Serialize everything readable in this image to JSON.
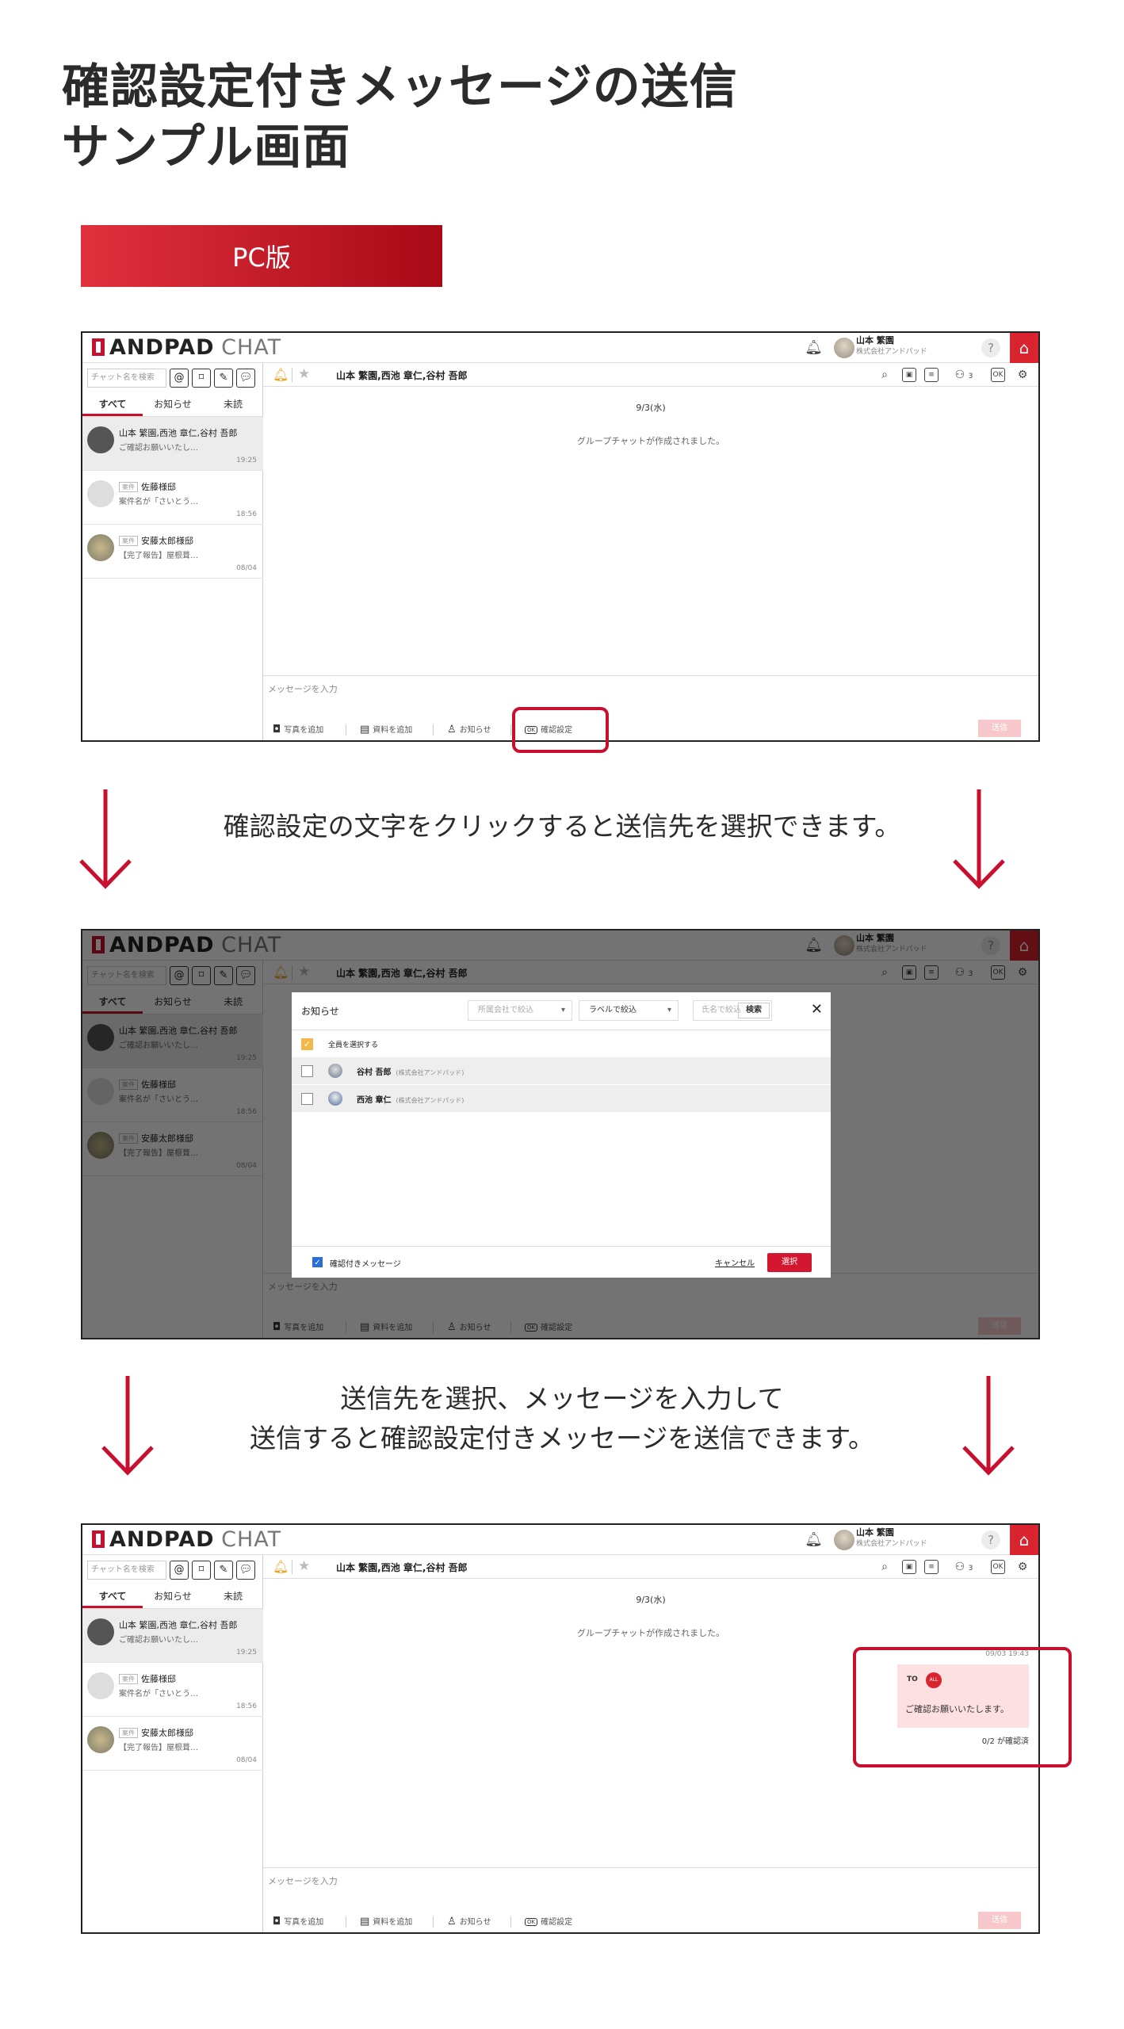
{
  "page": {
    "title_line1": "確認設定付きメッセージの送信",
    "title_line2": "サンプル画面",
    "badge": "PC版",
    "caption1": "確認設定の文字をクリックすると送信先を選択できます。",
    "caption2_line1": "送信先を選択、メッセージを入力して",
    "caption2_line2": "送信すると確認設定付きメッセージを送信できます。"
  },
  "app": {
    "logo_bold": "ANDPAD",
    "logo_light": "CHAT",
    "user_name": "山本 繁園",
    "user_company": "株式会社アンドパッド",
    "help": "?",
    "search_placeholder": "チャット名を検索",
    "tabs": [
      "すべて",
      "お知らせ",
      "未読"
    ],
    "rooms": [
      {
        "name": "山本 繁園,西池 章仁,谷村 吾郎",
        "tag": "",
        "msg": "ご確認お願いいたし…",
        "time": "19:25"
      },
      {
        "name": "佐藤様邸",
        "tag": "案件",
        "msg": "案件名が「さいとう…",
        "time": "18:56"
      },
      {
        "name": "安藤太郎様邸",
        "tag": "案件",
        "msg": "【完了報告】屋根葺…",
        "time": "08/04"
      }
    ],
    "chat_title": "山本 繁園,西池 章仁,谷村 吾郎",
    "member_count": "3",
    "date": "9/3(水)",
    "system_message": "グループチャットが作成されました。",
    "input_placeholder": "メッセージを入力",
    "toolbar": {
      "photo": "写真を追加",
      "doc": "資料を追加",
      "notice": "お知らせ",
      "confirm": "確認設定",
      "send": "送信"
    }
  },
  "modal": {
    "title": "お知らせ",
    "company_filter": "所属会社で絞込",
    "label_filter": "ラベルで絞込",
    "name_filter": "氏名で絞込",
    "search": "検索",
    "select_all": "全員を選択する",
    "members": [
      {
        "name": "谷村 吾郎",
        "company": "(株式会社アンドパッド)"
      },
      {
        "name": "西池 章仁",
        "company": "(株式会社アンドパッド)"
      }
    ],
    "confirm_label": "確認付きメッセージ",
    "cancel": "キャンセル",
    "select": "選択"
  },
  "message": {
    "time": "09/03 19:43",
    "to": "TO",
    "all": "ALL",
    "text": "ご確認お願いいたします。",
    "status": "0/2 が確認済"
  },
  "colors": {
    "accent": "#c8102e",
    "bubble": "#fde0e1"
  }
}
